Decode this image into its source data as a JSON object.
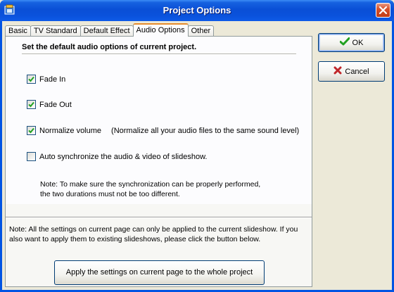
{
  "window": {
    "title": "Project Options",
    "app_icon": "project-app-icon",
    "close_icon": "close-icon"
  },
  "tabs": [
    {
      "label": "Basic",
      "active": false
    },
    {
      "label": "TV Standard",
      "active": false
    },
    {
      "label": "Default Effect",
      "active": false
    },
    {
      "label": "Audio Options",
      "active": true
    },
    {
      "label": "Other",
      "active": false
    }
  ],
  "audio": {
    "heading": "Set the default audio options of current project.",
    "options": [
      {
        "label": "Fade In",
        "checked": true,
        "hint": ""
      },
      {
        "label": "Fade Out",
        "checked": true,
        "hint": ""
      },
      {
        "label": "Normalize volume",
        "checked": true,
        "hint": "(Normalize all your audio files to the same sound level)"
      },
      {
        "label": "Auto synchronize the audio & video of slideshow.",
        "checked": false,
        "hint": ""
      }
    ],
    "sync_note": "Note: To make sure the synchronization can be properly performed, the two durations must not be too different."
  },
  "footer": {
    "note": "Note: All the settings on current page can only be applied to the current slideshow. If you also want to apply them to existing slideshows, please click the button below.",
    "apply_label": "Apply the settings on current page to the whole project"
  },
  "buttons": {
    "ok_label": "OK",
    "ok_icon": "checkmark-icon",
    "cancel_label": "Cancel",
    "cancel_icon": "x-icon"
  },
  "colors": {
    "titlebar": "#0a52dc",
    "active_tab_accent": "#e68b2c",
    "check_green": "#21a121",
    "cancel_red": "#c0262a"
  }
}
